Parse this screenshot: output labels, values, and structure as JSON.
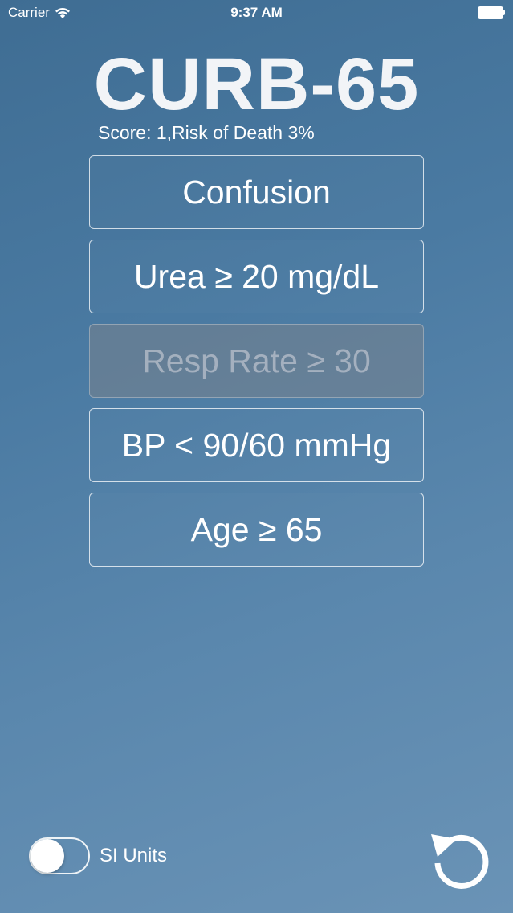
{
  "status_bar": {
    "carrier": "Carrier",
    "time": "9:37 AM",
    "wifi_icon": "wifi-icon",
    "battery_icon": "battery-icon"
  },
  "app": {
    "title": "CURB-65",
    "score_text": "Score: 1,Risk of Death 3%"
  },
  "criteria": [
    {
      "label": "Confusion",
      "selected": false
    },
    {
      "label": "Urea ≥ 20 mg/dL",
      "selected": false
    },
    {
      "label": "Resp Rate ≥ 30",
      "selected": true
    },
    {
      "label": "BP < 90/60 mmHg",
      "selected": false
    },
    {
      "label": "Age ≥ 65",
      "selected": false
    }
  ],
  "footer": {
    "si_units_label": "SI Units",
    "si_units_on": false,
    "reset_icon": "reset-icon"
  },
  "colors": {
    "background_start": "#3f6d93",
    "background_end": "#6a93b6",
    "text": "#ffffff",
    "selected_fill": "#7a8490"
  }
}
